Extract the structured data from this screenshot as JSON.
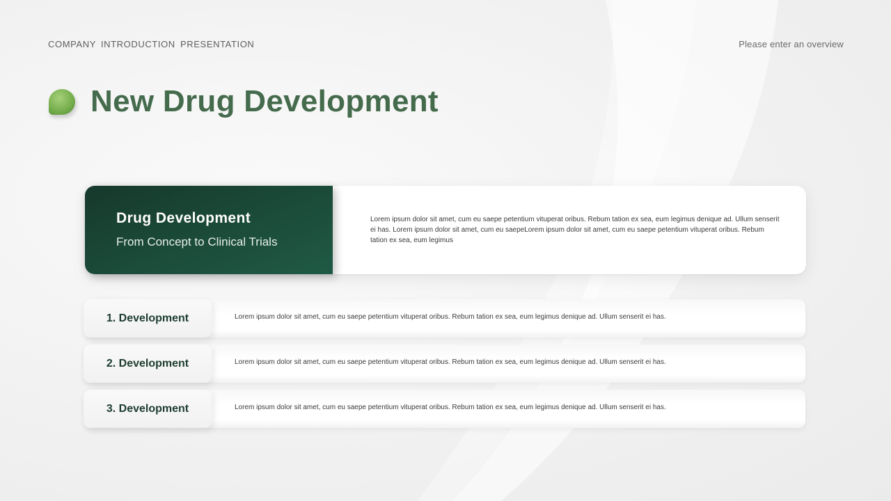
{
  "header": {
    "left_text": "COMPANY  INTRODUCTION  PRESENTATION",
    "right_text": "Please enter an overview"
  },
  "title": "New Drug Development",
  "hero": {
    "heading": "Drug Development",
    "subheading": "From Concept to Clinical Trials",
    "body": "Lorem ipsum dolor sit amet, cum eu saepe petentium vituperat oribus. Rebum tation ex sea, eum legimus denique ad. Ullum senserit ei has. Lorem ipsum dolor sit amet, cum eu saepeLorem ipsum dolor sit amet, cum eu saepe petentium vituperat oribus. Rebum tation ex sea, eum legimus"
  },
  "items": [
    {
      "label": "1. Development",
      "text": "Lorem ipsum dolor sit amet, cum eu saepe petentium vituperat oribus. Rebum tation ex sea, eum legimus denique ad. Ullum senserit ei has."
    },
    {
      "label": "2. Development",
      "text": "Lorem ipsum dolor sit amet, cum eu saepe petentium vituperat oribus. Rebum tation ex sea, eum legimus denique ad. Ullum senserit ei has."
    },
    {
      "label": "3. Development",
      "text": "Lorem ipsum dolor sit amet, cum eu saepe petentium vituperat oribus. Rebum tation ex sea, eum legimus denique ad. Ullum senserit ei has."
    }
  ],
  "colors": {
    "title_green": "#456b4d",
    "panel_dark_green": "#1b4a38",
    "accent_light_green": "#78b04e"
  }
}
